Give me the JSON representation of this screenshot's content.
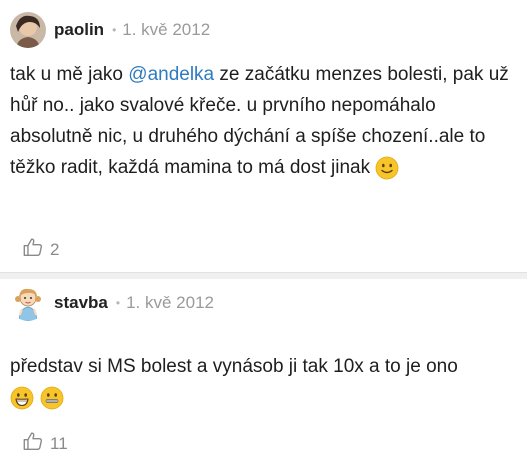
{
  "comments": [
    {
      "author": "paolin",
      "separator": "•",
      "date": "1. kvě 2012",
      "text_before": "tak u mě jako ",
      "mention": "@andelka",
      "text_after": " ze začátku menzes bolesti, pak už hůř no.. jako svalové křeče. u prvního nepomáhalo absolutně nic, u druhého dýchání a spíše chození..ale to těžko radit, každá mamina to má dost jinak ",
      "emojis": [
        "slightly-smiling-face"
      ],
      "likes": "2"
    },
    {
      "author": "stavba",
      "separator": "•",
      "date": "1. kvě 2012",
      "text": "představ si MS bolest a vynásob ji tak 10x a to je ono",
      "emojis": [
        "grinning-face",
        "zipper-mouth-face"
      ],
      "likes": "11"
    }
  ],
  "colors": {
    "mention": "#2f7bbf",
    "date": "#9a9a9a",
    "separator_band": "#f0f0f0",
    "emoji": "#f7c42a"
  }
}
